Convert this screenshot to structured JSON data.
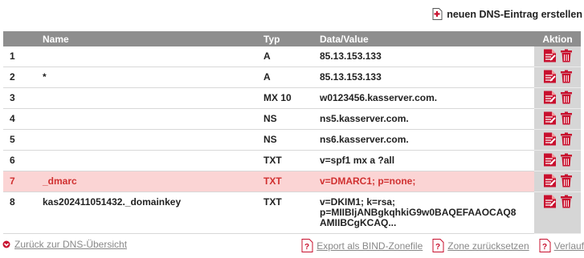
{
  "top_action": {
    "label": "neuen DNS-Eintrag erstellen",
    "icon": "document-add-icon"
  },
  "table": {
    "headers": {
      "name": "Name",
      "typ": "Typ",
      "data": "Data/Value",
      "aktion": "Aktion"
    },
    "rows": [
      {
        "nr": "1",
        "name": "",
        "typ": "A",
        "data": "85.13.153.133"
      },
      {
        "nr": "2",
        "name": "*",
        "typ": "A",
        "data": "85.13.153.133"
      },
      {
        "nr": "3",
        "name": "",
        "typ": "MX 10",
        "data": "w0123456.kasserver.com."
      },
      {
        "nr": "4",
        "name": "",
        "typ": "NS",
        "data": "ns5.kasserver.com."
      },
      {
        "nr": "5",
        "name": "",
        "typ": "NS",
        "data": "ns6.kasserver.com."
      },
      {
        "nr": "6",
        "name": "",
        "typ": "TXT",
        "data": "v=spf1 mx a ?all"
      },
      {
        "nr": "7",
        "name": "_dmarc",
        "typ": "TXT",
        "data": "v=DMARC1; p=none;"
      },
      {
        "nr": "8",
        "name": "kas202411051432._domainkey",
        "typ": "TXT",
        "data_lines": [
          "v=DKIM1; k=rsa;",
          "p=MIIBIjANBgkqhkiG9w0BAQEFAAOCAQ8",
          "AMIIBCgKCAQ..."
        ]
      }
    ]
  },
  "footer": {
    "back_label": "Zurück zur DNS-Übersicht",
    "export_label": "Export als BIND-Zonefile",
    "reset_label": "Zone zurücksetzen",
    "history_label": "Verlauf"
  },
  "colors": {
    "header_bg": "#8e8e8e",
    "action_col_bg": "#d6d6d6",
    "highlight_row_bg": "#fbd4d4",
    "highlight_text": "#d03030",
    "icon_red": "#c8102e",
    "link_gray": "#888888"
  }
}
